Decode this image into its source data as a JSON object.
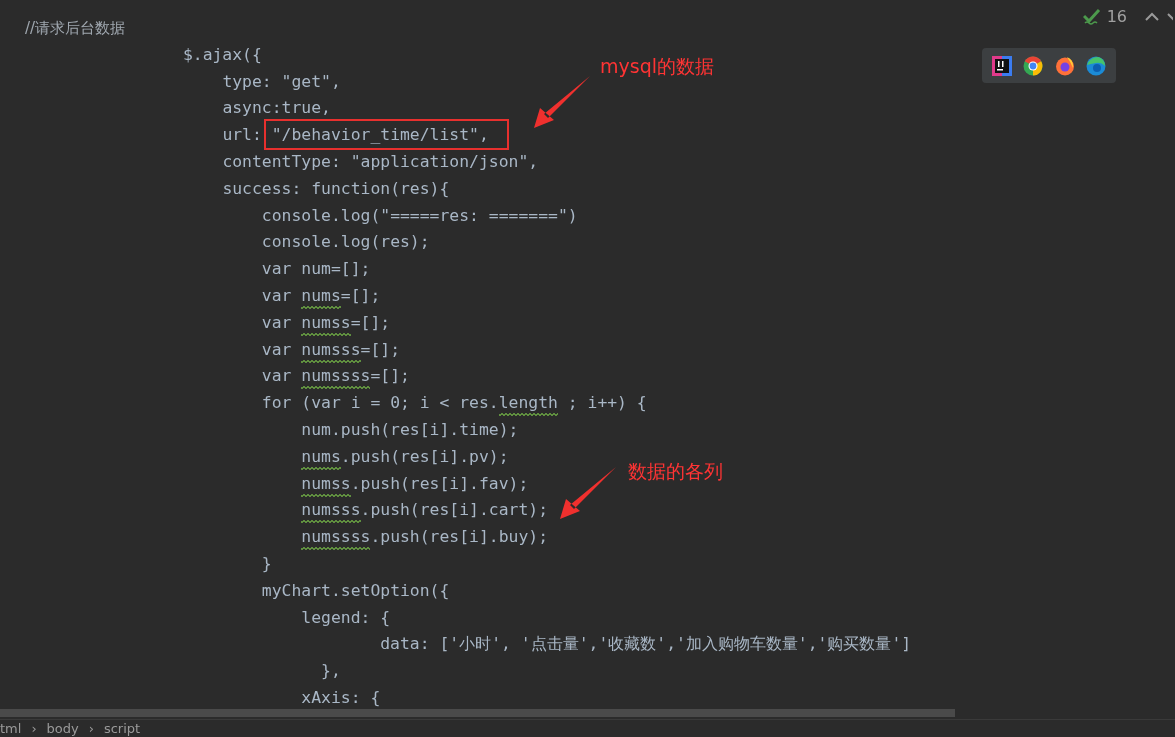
{
  "inspections": {
    "count": "16"
  },
  "editor": {
    "lines": [
      {
        "kind": "comment",
        "parts": [
          {
            "text": "//请求后台数据",
            "warning": false,
            "highlighted": false
          }
        ]
      },
      {
        "kind": "code",
        "parts": [
          {
            "text": "                $.ajax({",
            "warning": false,
            "highlighted": false
          }
        ]
      },
      {
        "kind": "code",
        "parts": [
          {
            "text": "                    type: \"get\",",
            "warning": false,
            "highlighted": false
          }
        ]
      },
      {
        "kind": "code",
        "parts": [
          {
            "text": "                    async:true,",
            "warning": false,
            "highlighted": false
          }
        ]
      },
      {
        "kind": "code",
        "parts": [
          {
            "text": "                    url: ",
            "warning": false,
            "highlighted": false
          },
          {
            "text": "\"/behavior_time/list\",",
            "warning": false,
            "highlighted": true
          }
        ]
      },
      {
        "kind": "code",
        "parts": [
          {
            "text": "                    contentType: \"application/json\",",
            "warning": false,
            "highlighted": false
          }
        ]
      },
      {
        "kind": "code",
        "parts": [
          {
            "text": "                    success: function(res){",
            "warning": false,
            "highlighted": false
          }
        ]
      },
      {
        "kind": "code",
        "parts": [
          {
            "text": "                        console.log(\"=====res: =======\")",
            "warning": false,
            "highlighted": false
          }
        ]
      },
      {
        "kind": "code",
        "parts": [
          {
            "text": "                        console.log(res);",
            "warning": false,
            "highlighted": false
          }
        ]
      },
      {
        "kind": "code",
        "parts": [
          {
            "text": "                        var num=[];",
            "warning": false,
            "highlighted": false
          }
        ]
      },
      {
        "kind": "code",
        "parts": [
          {
            "text": "                        var ",
            "warning": false,
            "highlighted": false
          },
          {
            "text": "nums",
            "warning": true,
            "highlighted": false
          },
          {
            "text": "=[];",
            "warning": false,
            "highlighted": false
          }
        ]
      },
      {
        "kind": "code",
        "parts": [
          {
            "text": "                        var ",
            "warning": false,
            "highlighted": false
          },
          {
            "text": "numss",
            "warning": true,
            "highlighted": false
          },
          {
            "text": "=[];",
            "warning": false,
            "highlighted": false
          }
        ]
      },
      {
        "kind": "code",
        "parts": [
          {
            "text": "                        var ",
            "warning": false,
            "highlighted": false
          },
          {
            "text": "numsss",
            "warning": true,
            "highlighted": false
          },
          {
            "text": "=[];",
            "warning": false,
            "highlighted": false
          }
        ]
      },
      {
        "kind": "code",
        "parts": [
          {
            "text": "                        var ",
            "warning": false,
            "highlighted": false
          },
          {
            "text": "numssss",
            "warning": true,
            "highlighted": false
          },
          {
            "text": "=[];",
            "warning": false,
            "highlighted": false
          }
        ]
      },
      {
        "kind": "code",
        "parts": [
          {
            "text": "                        for (var i = 0; i < res.",
            "warning": false,
            "highlighted": false
          },
          {
            "text": "length",
            "warning": true,
            "highlighted": false
          },
          {
            "text": " ; i++) {",
            "warning": false,
            "highlighted": false
          }
        ]
      },
      {
        "kind": "code",
        "parts": [
          {
            "text": "                            num.push(res[i].time);",
            "warning": false,
            "highlighted": false
          }
        ]
      },
      {
        "kind": "code",
        "parts": [
          {
            "text": "                            nums",
            "warning": true,
            "highlighted": false
          },
          {
            "text": ".push(res[i].pv);",
            "warning": false,
            "highlighted": false
          }
        ]
      },
      {
        "kind": "code",
        "parts": [
          {
            "text": "                            numss",
            "warning": true,
            "highlighted": false
          },
          {
            "text": ".push(res[i].fav);",
            "warning": false,
            "highlighted": false
          }
        ]
      },
      {
        "kind": "code",
        "parts": [
          {
            "text": "                            numsss",
            "warning": true,
            "highlighted": false
          },
          {
            "text": ".push(res[i].cart);",
            "warning": false,
            "highlighted": false
          }
        ]
      },
      {
        "kind": "code",
        "parts": [
          {
            "text": "                            numssss",
            "warning": true,
            "highlighted": false
          },
          {
            "text": ".push(res[i].buy);",
            "warning": false,
            "highlighted": false
          }
        ]
      },
      {
        "kind": "code",
        "parts": [
          {
            "text": "                        }",
            "warning": false,
            "highlighted": false
          }
        ]
      },
      {
        "kind": "code",
        "parts": [
          {
            "text": "                        myChart.setOption({",
            "warning": false,
            "highlighted": false
          }
        ]
      },
      {
        "kind": "code",
        "parts": [
          {
            "text": "                            legend: {",
            "warning": false,
            "highlighted": false
          }
        ]
      },
      {
        "kind": "code",
        "parts": [
          {
            "text": "                                    data: ['小时', '点击量','收藏数','加入购物车数量','购买数量']",
            "warning": false,
            "highlighted": false
          }
        ]
      },
      {
        "kind": "code",
        "parts": [
          {
            "text": "                              },",
            "warning": false,
            "highlighted": false
          }
        ]
      },
      {
        "kind": "code",
        "parts": [
          {
            "text": "                            xAxis: {",
            "warning": false,
            "highlighted": false
          }
        ]
      }
    ]
  },
  "annotations": [
    {
      "text": "mysql的数据"
    },
    {
      "text": "数据的各列"
    }
  ],
  "breadcrumb": [
    "tml",
    "›",
    "body",
    "›",
    "script"
  ]
}
